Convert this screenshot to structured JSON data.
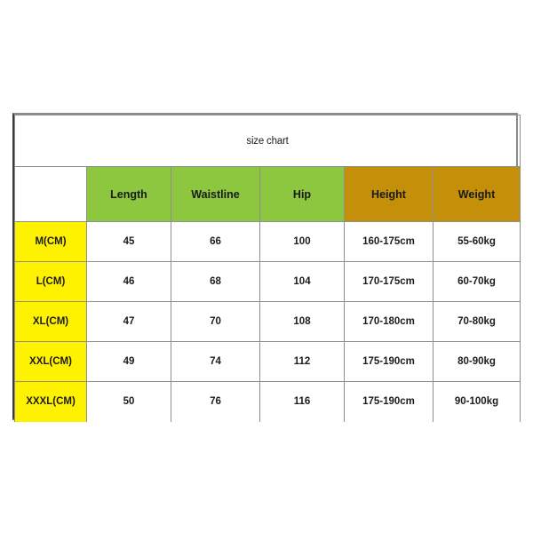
{
  "chart": {
    "title": "size chart",
    "corner_label": "",
    "column_headers": [
      "Length",
      "Waistline",
      "Hip",
      "Height",
      "Weight"
    ],
    "header_colors": {
      "green": "#8dc63f",
      "gold": "#c4900a",
      "yellow": "#fff200"
    },
    "rows": [
      {
        "size": "M(CM)",
        "length": "45",
        "waistline": "66",
        "hip": "100",
        "height": "160-175cm",
        "weight": "55-60kg"
      },
      {
        "size": "L(CM)",
        "length": "46",
        "waistline": "68",
        "hip": "104",
        "height": "170-175cm",
        "weight": "60-70kg"
      },
      {
        "size": "XL(CM)",
        "length": "47",
        "waistline": "70",
        "hip": "108",
        "height": "170-180cm",
        "weight": "70-80kg"
      },
      {
        "size": "XXL(CM)",
        "length": "49",
        "waistline": "74",
        "hip": "112",
        "height": "175-190cm",
        "weight": "80-90kg"
      },
      {
        "size": "XXXL(CM)",
        "length": "50",
        "waistline": "76",
        "hip": "116",
        "height": "175-190cm",
        "weight": "90-100kg"
      }
    ]
  },
  "chart_data": {
    "type": "table",
    "title": "size chart",
    "columns": [
      "",
      "Length",
      "Waistline",
      "Hip",
      "Height",
      "Weight"
    ],
    "rows": [
      [
        "M(CM)",
        "45",
        "66",
        "100",
        "160-175cm",
        "55-60kg"
      ],
      [
        "L(CM)",
        "46",
        "68",
        "104",
        "170-175cm",
        "60-70kg"
      ],
      [
        "XL(CM)",
        "47",
        "70",
        "108",
        "170-180cm",
        "70-80kg"
      ],
      [
        "XXL(CM)",
        "49",
        "74",
        "112",
        "175-190cm",
        "80-90kg"
      ],
      [
        "XXXL(CM)",
        "50",
        "76",
        "116",
        "175-190cm",
        "90-100kg"
      ]
    ]
  }
}
